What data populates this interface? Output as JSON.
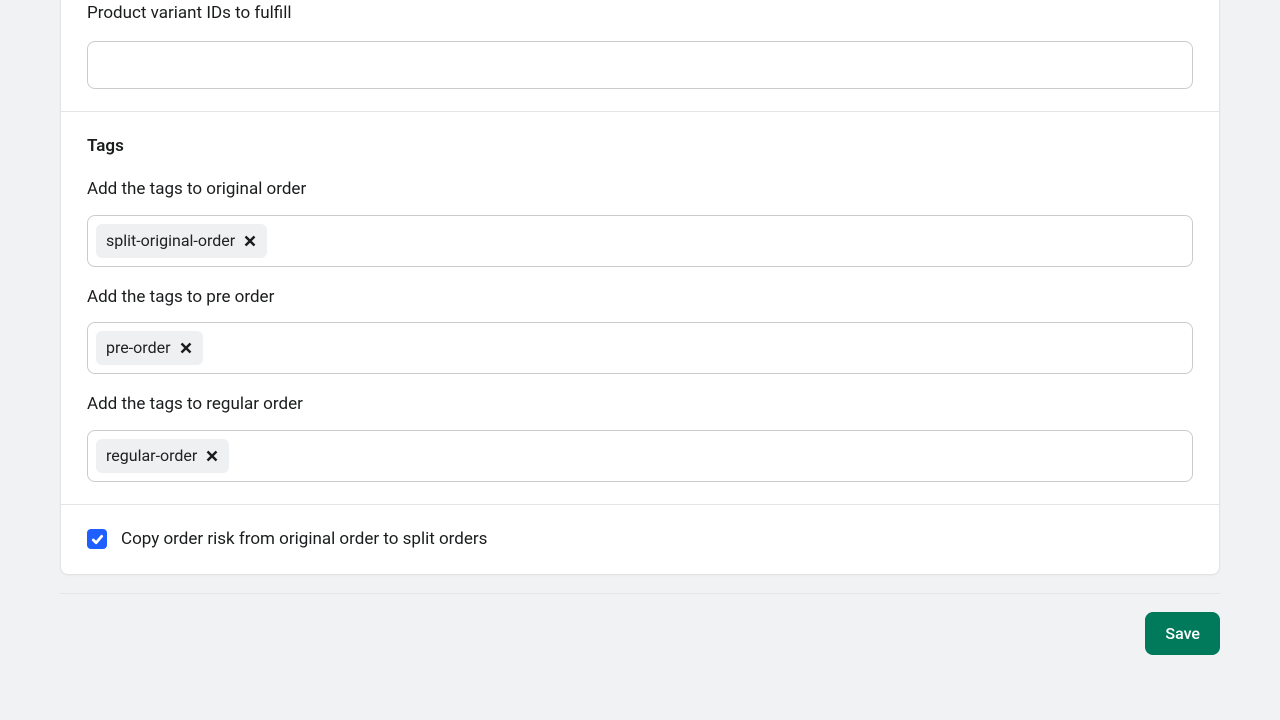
{
  "variant_section": {
    "label": "Product variant IDs to fulfill",
    "value": ""
  },
  "tags_section": {
    "title": "Tags",
    "original": {
      "label": "Add the tags to original order",
      "tags": [
        "split-original-order"
      ]
    },
    "preorder": {
      "label": "Add the tags to pre order",
      "tags": [
        "pre-order"
      ]
    },
    "regular": {
      "label": "Add the tags to regular order",
      "tags": [
        "regular-order"
      ]
    }
  },
  "copy_risk": {
    "checked": true,
    "label": "Copy order risk from original order to split orders"
  },
  "footer": {
    "save_label": "Save"
  }
}
